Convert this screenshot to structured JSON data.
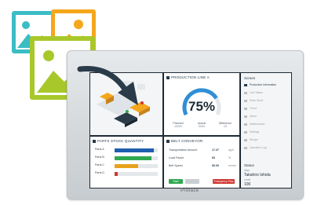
{
  "brand": "Proface",
  "production": {
    "title": "PRODUCTION LINE A",
    "percent_label": "75%",
    "percent_value": 75,
    "stats": [
      {
        "label": "Planned",
        "value": "10000"
      },
      {
        "label": "Actual",
        "value": "5000"
      },
      {
        "label": "Difference",
        "value": "C5"
      }
    ]
  },
  "parts": {
    "title": "PARTS STOCK QUANTITY",
    "rows": [
      {
        "label": "Parts A",
        "count": "",
        "fill": 0.9,
        "color": "#1e5fae"
      },
      {
        "label": "Parts B",
        "count": "",
        "fill": 0.85,
        "color": "#2fa84f"
      },
      {
        "label": "Parts C",
        "count": "",
        "fill": 0.55,
        "color": "#e8a21b"
      },
      {
        "label": "Parts D",
        "count": "",
        "fill": 0.08,
        "color": "#d0352f"
      }
    ]
  },
  "belt": {
    "title": "BELT CONVEYOR",
    "rows": [
      {
        "label": "Transportation Amount",
        "value": "17.37",
        "unit": "kg/h"
      },
      {
        "label": "Load Factor",
        "value": "83",
        "unit": "%"
      },
      {
        "label": "Belt Speed",
        "value": "50.00",
        "unit": "m/min"
      }
    ],
    "buttons": [
      {
        "label": "Start",
        "color": "#2fa84f"
      },
      {
        "label": "",
        "color": "#c9ced2"
      },
      {
        "label": "Emergency Stop",
        "color": "#d0352f"
      }
    ]
  },
  "sidebar": {
    "title": "Screen",
    "items": [
      {
        "label": "Production Information",
        "active": true
      },
      {
        "label": "Line Status",
        "active": false
      },
      {
        "label": "Parts Stock",
        "active": false
      },
      {
        "label": "Trend",
        "active": false
      },
      {
        "label": "Alarm",
        "active": false
      },
      {
        "label": "Maintenance",
        "active": false
      },
      {
        "label": "Settings",
        "active": false
      },
      {
        "label": "Recipe",
        "active": false
      },
      {
        "label": "Operation Log",
        "active": false
      }
    ],
    "status_title": "Status",
    "status_user_label": "User",
    "status_user": "Takahiro Ishida",
    "status_level_label": "Level",
    "status_level": "100"
  }
}
